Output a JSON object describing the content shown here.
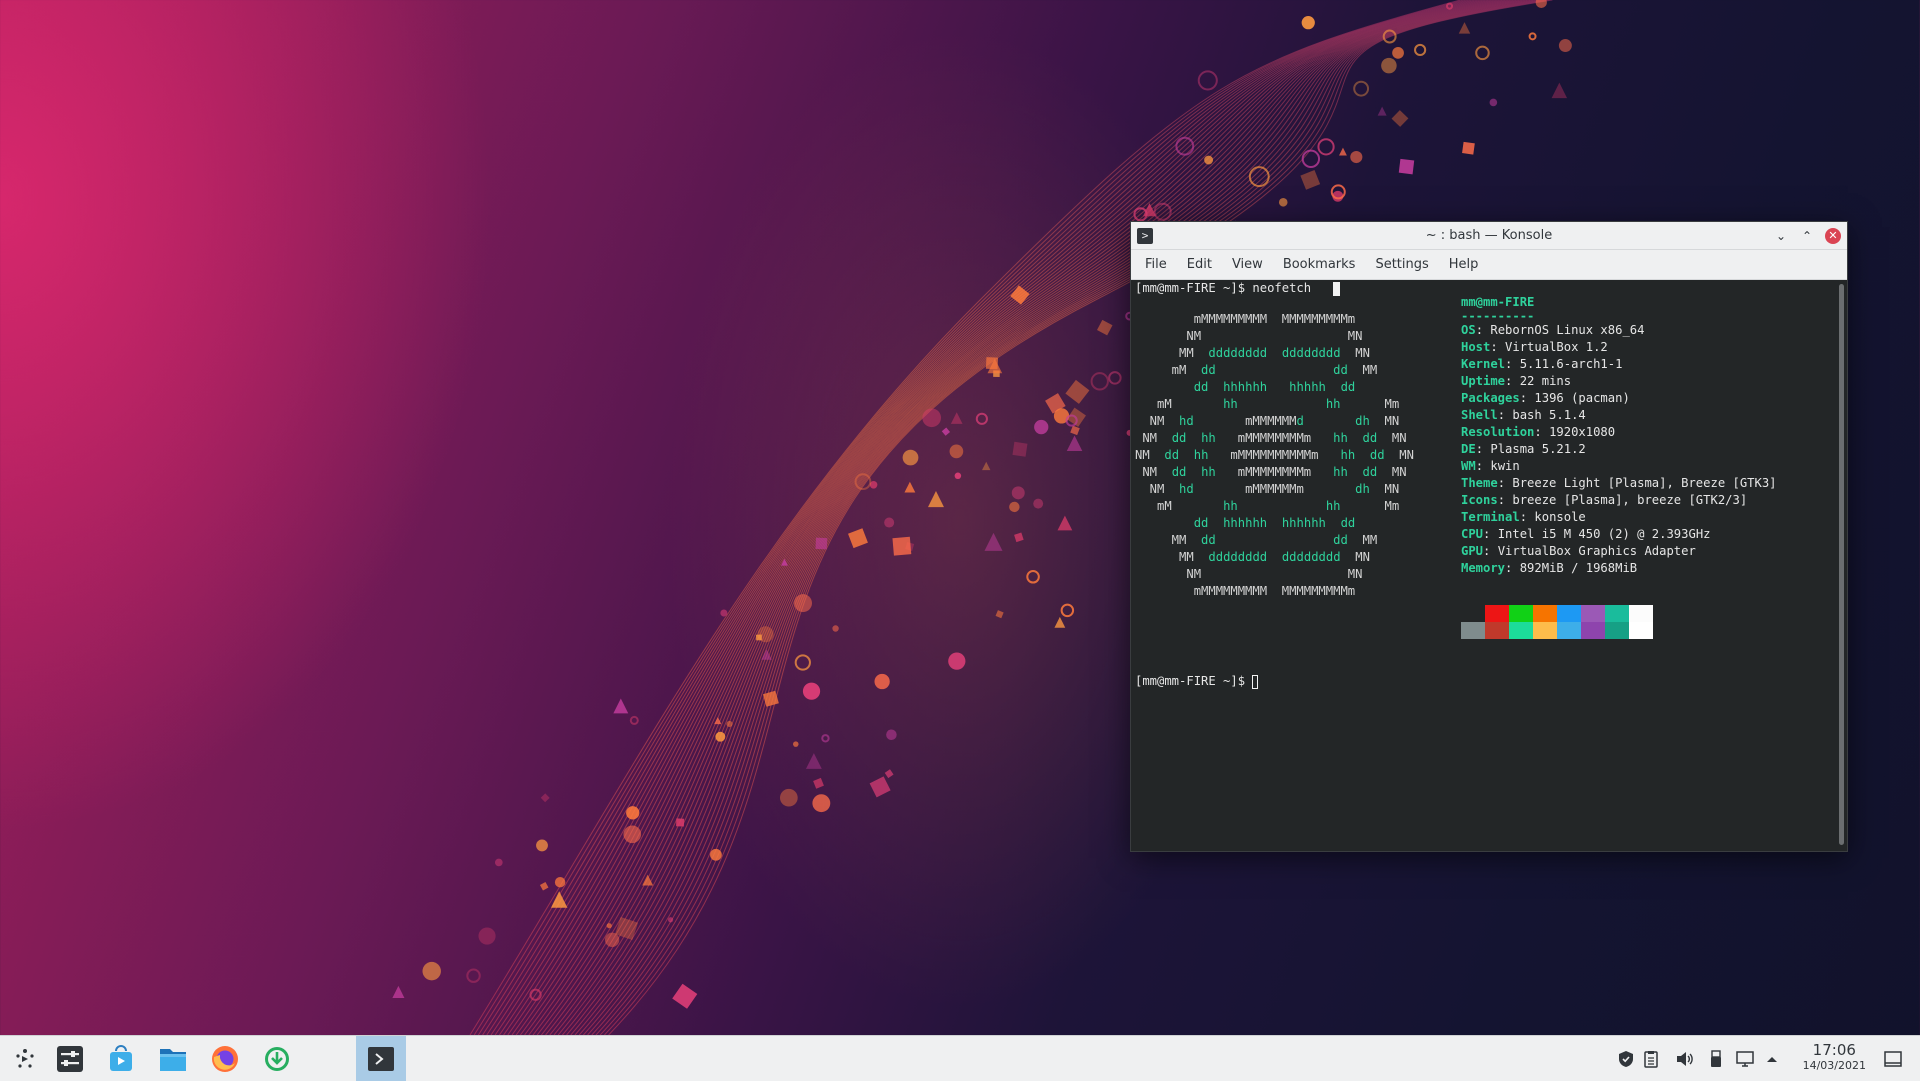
{
  "window": {
    "title": "~ : bash — Konsole",
    "app_icon": ">",
    "buttons": [
      "minimize-icon",
      "maximize-icon",
      "close-icon"
    ]
  },
  "menubar": [
    "File",
    "Edit",
    "View",
    "Bookmarks",
    "Settings",
    "Help"
  ],
  "terminal": {
    "prompt1": "[mm@mm-FIRE ~]$ neofetch",
    "prompt2": "[mm@mm-FIRE ~]$ ",
    "user_host": "mm@mm-FIRE",
    "separator": "----------",
    "info": [
      {
        "key": "OS",
        "value": "RebornOS Linux x86_64"
      },
      {
        "key": "Host",
        "value": "VirtualBox 1.2"
      },
      {
        "key": "Kernel",
        "value": "5.11.6-arch1-1"
      },
      {
        "key": "Uptime",
        "value": "22 mins"
      },
      {
        "key": "Packages",
        "value": "1396 (pacman)"
      },
      {
        "key": "Shell",
        "value": "bash 5.1.4"
      },
      {
        "key": "Resolution",
        "value": "1920x1080"
      },
      {
        "key": "DE",
        "value": "Plasma 5.21.2"
      },
      {
        "key": "WM",
        "value": "kwin"
      },
      {
        "key": "Theme",
        "value": "Breeze Light [Plasma], Breeze [GTK3]"
      },
      {
        "key": "Icons",
        "value": "breeze [Plasma], breeze [GTK2/3]"
      },
      {
        "key": "Terminal",
        "value": "konsole"
      },
      {
        "key": "CPU",
        "value": "Intel i5 M 450 (2) @ 2.393GHz"
      },
      {
        "key": "GPU",
        "value": "VirtualBox Graphics Adapter"
      },
      {
        "key": "Memory",
        "value": "892MiB / 1968MiB"
      }
    ],
    "logo": [
      "        mMMMMMMMMM  MMMMMMMMMm",
      "       NM                    MN",
      "      MM  dddddddd  dddddddd  MN",
      "     mM  dd                dd  MM",
      "        dd  hhhhhh   hhhhh  dd",
      "   mM       hh            hh      Mm",
      "  NM  hd       mMMMMMMd       dh  MN",
      " NM  dd  hh   mMMMMMMMMm   hh  dd  MN",
      "NM  dd  hh   mMMMMMMMMMMm   hh  dd  MN",
      " NM  dd  hh   mMMMMMMMMm   hh  dd  MN",
      "  NM  hd       mMMMMMMm       dh  MN",
      "   mM       hh            hh      Mm",
      "        dd  hhhhhh  hhhhhh  dd",
      "     MM  dd                dd  MM",
      "      MM  dddddddd  dddddddd  MN",
      "       NM                    MN",
      "        mMMMMMMMMM  MMMMMMMMMm"
    ],
    "palette_top": [
      "#232627",
      "#ed1515",
      "#11d116",
      "#f67400",
      "#1d99f3",
      "#9b59b6",
      "#1abc9c",
      "#fcfcfc"
    ],
    "palette_bottom": [
      "#7f8c8d",
      "#c0392b",
      "#1cdc9a",
      "#fdbc4b",
      "#3daee9",
      "#8e44ad",
      "#16a085",
      "#ffffff"
    ]
  },
  "taskbar": {
    "items": [
      {
        "name": "application-launcher-icon",
        "active": false
      },
      {
        "name": "system-settings-icon",
        "active": false
      },
      {
        "name": "discover-store-icon",
        "active": false
      },
      {
        "name": "dolphin-file-manager-icon",
        "active": false
      },
      {
        "name": "firefox-icon",
        "active": false
      },
      {
        "name": "software-update-icon",
        "active": false
      },
      {
        "name": "konsole-task-icon",
        "active": true
      }
    ],
    "tray": [
      "shield-icon",
      "clipboard-icon",
      "volume-icon",
      "usb-device-icon",
      "network-icon",
      "expand-tray-icon"
    ],
    "time": "17:06",
    "date": "14/03/2021"
  },
  "colors": {
    "terminal_bg": "#232627",
    "accent_green": "#2fd29c",
    "close_red": "#da4453",
    "active_task": "#a9cbe6"
  }
}
